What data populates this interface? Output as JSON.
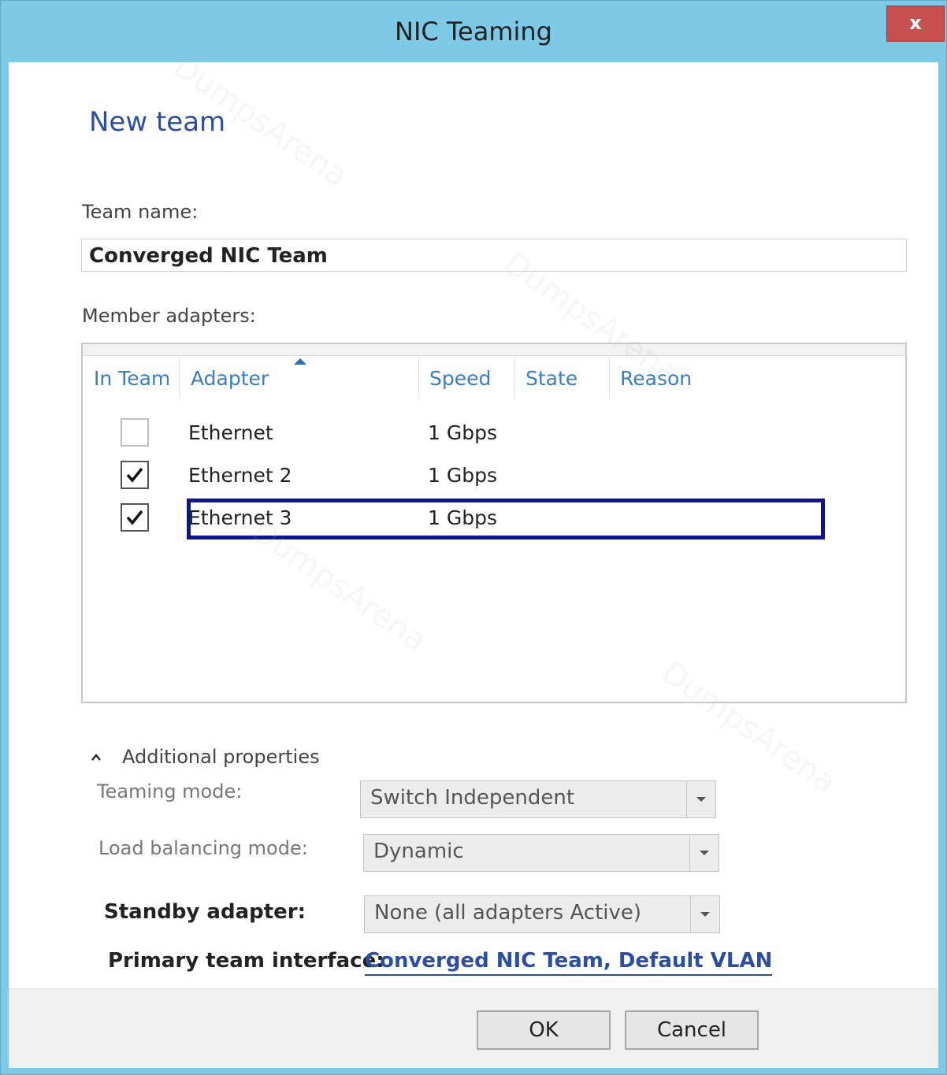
{
  "window": {
    "title": "NIC Teaming",
    "close_label": "x"
  },
  "page": {
    "heading": "New team"
  },
  "team_name": {
    "label": "Team name:",
    "value": "Converged NIC Team"
  },
  "member_adapters": {
    "label": "Member adapters:",
    "columns": [
      "In Team",
      "Adapter",
      "Speed",
      "State",
      "Reason"
    ],
    "rows": [
      {
        "in_team": false,
        "adapter": "Ethernet",
        "speed": "1 Gbps",
        "state": "",
        "reason": ""
      },
      {
        "in_team": true,
        "adapter": "Ethernet 2",
        "speed": "1 Gbps",
        "state": "",
        "reason": ""
      },
      {
        "in_team": true,
        "adapter": "Ethernet 3",
        "speed": "1 Gbps",
        "state": "",
        "reason": ""
      }
    ]
  },
  "additional_properties": {
    "label": "Additional properties",
    "teaming_mode": {
      "label": "Teaming mode:",
      "value": "Switch Independent"
    },
    "load_balancing_mode": {
      "label": "Load balancing mode:",
      "value": "Dynamic"
    },
    "standby_adapter": {
      "label": "Standby adapter:",
      "value": "None (all adapters Active)"
    },
    "primary_team_interface": {
      "label": "Primary team interface:",
      "value": "Converged NIC Team, Default VLAN"
    }
  },
  "buttons": {
    "ok": "OK",
    "cancel": "Cancel"
  },
  "watermark_text": "DumpsArena",
  "colors": {
    "title_bar": "#7ec9e6",
    "heading": "#2b4ea0",
    "column_header": "#3a7dc2",
    "selection_border": "#10148c"
  }
}
